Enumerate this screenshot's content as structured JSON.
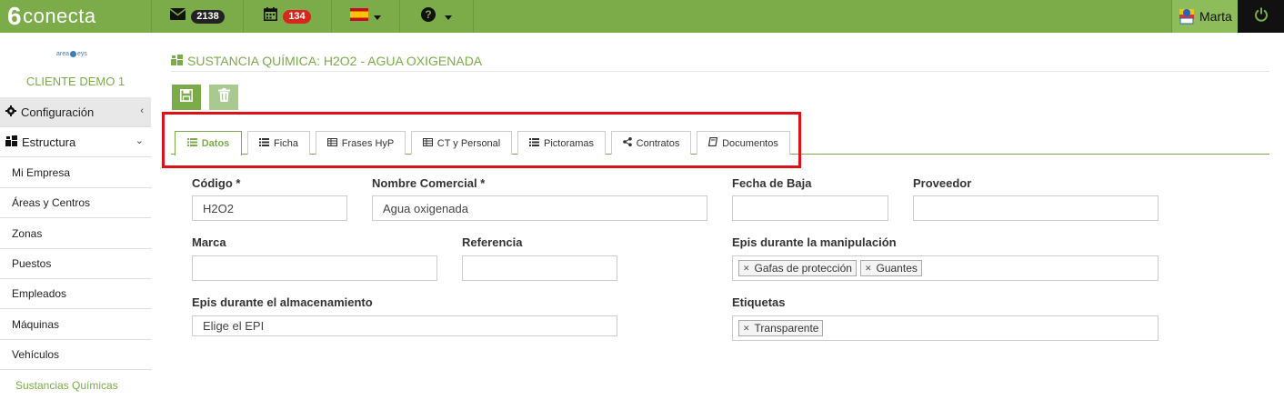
{
  "header": {
    "logo_mark": "6",
    "logo_text": "conecta",
    "mail_count": "2138",
    "calendar_count": "134",
    "user_name": "Marta"
  },
  "icons": {
    "mail": "mail-icon",
    "calendar": "calendar-icon",
    "language": "spain-flag-icon",
    "help": "help-icon",
    "power": "power-icon",
    "save": "save-icon",
    "delete": "trash-icon"
  },
  "colors": {
    "accent": "#7cab4a",
    "highlight_box": "#e0101a",
    "badge_red": "#d9261c"
  },
  "sidebar": {
    "brand_left": "area",
    "brand_right": "eys",
    "client": "CLIENTE DEMO 1",
    "config_label": "Configuración",
    "structure_label": "Estructura",
    "items": [
      "Mi Empresa",
      "Áreas y Centros",
      "Zonas",
      "Puestos",
      "Empleados",
      "Máquinas",
      "Vehículos",
      "Sustancias Químicas"
    ]
  },
  "page": {
    "title": "SUSTANCIA QUÍMICA: H2O2 - AGUA OXIGENADA"
  },
  "tabs": [
    "Datos",
    "Ficha",
    "Frases HyP",
    "CT y Personal",
    "Pictoramas",
    "Contratos",
    "Documentos"
  ],
  "form": {
    "codigo_label": "Código *",
    "codigo_value": "H2O2",
    "nombre_label": "Nombre Comercial *",
    "nombre_value": "Agua oxigenada",
    "fecha_baja_label": "Fecha de Baja",
    "fecha_baja_value": "",
    "proveedor_label": "Proveedor",
    "proveedor_value": "",
    "marca_label": "Marca",
    "marca_value": "",
    "referencia_label": "Referencia",
    "referencia_value": "",
    "epis_manip_label": "Epis durante la manipulación",
    "epis_manip_tags": [
      "Gafas de protección",
      "Guantes"
    ],
    "epis_alm_label": "Epis durante el almacenamiento",
    "epis_alm_placeholder": "Elige el EPI",
    "etiquetas_label": "Etiquetas",
    "etiquetas_tags": [
      "Transparente"
    ]
  }
}
